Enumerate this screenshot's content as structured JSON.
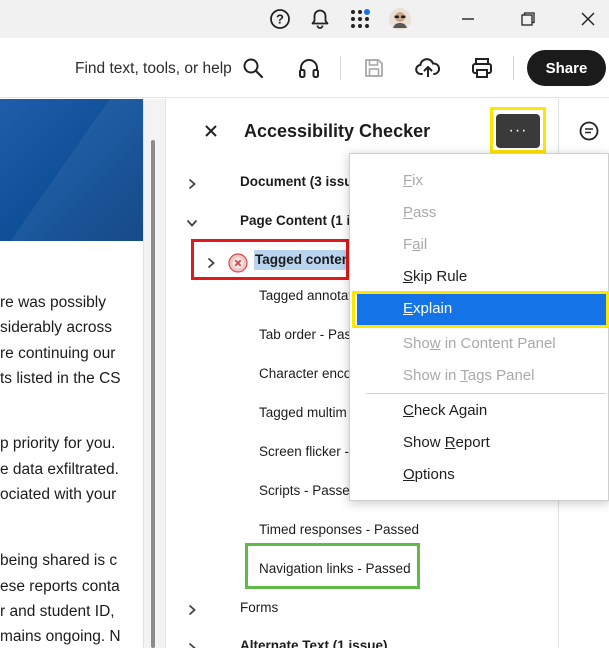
{
  "toolbar": {
    "find_text": "Find text, tools, or help",
    "share_label": "Share"
  },
  "document": {
    "lines": [
      "re was possibly",
      "siderably across",
      "re continuing our",
      "ts listed in the CS",
      "p priority for you.",
      "e data exfiltrated.",
      "ociated with your",
      "being shared is c",
      "ese reports conta",
      "r and student ID,",
      "mains ongoing. N"
    ]
  },
  "panel": {
    "title": "Accessibility Checker",
    "more_label": "···",
    "tree": {
      "document": "Document (3 issu",
      "page_content": "Page Content (1 is",
      "tagged_content": "Tagged conten",
      "tagged_annotations": "Tagged annotat",
      "tab_order": "Tab order - Pass",
      "character_encoding": "Character enco",
      "tagged_multimedia": "Tagged multim",
      "screen_flicker": "Screen flicker -",
      "scripts": "Scripts - Passed",
      "timed_responses": "Timed responses - Passed",
      "navigation_links": "Navigation links - Passed",
      "forms": "Forms",
      "alternate_text": "Alternate Text (1 issue)"
    }
  },
  "menu": {
    "fix": {
      "u": "F",
      "rest": "ix"
    },
    "pass": {
      "u": "P",
      "rest": "ass"
    },
    "fail": {
      "pre": "F",
      "u": "a",
      "rest": "il"
    },
    "skip_rule": {
      "u": "S",
      "rest": "kip Rule"
    },
    "explain": {
      "u": "E",
      "rest": "xplain"
    },
    "show_content": {
      "pre": "Sho",
      "u": "w",
      "rest": " in Content Panel"
    },
    "show_tags": {
      "pre": "Show in ",
      "u": "T",
      "rest": "ags Panel"
    },
    "check_again": {
      "u": "C",
      "rest": "heck Again"
    },
    "show_report": {
      "pre": "Show ",
      "u": "R",
      "rest": "eport"
    },
    "options": {
      "u": "O",
      "rest": "ptions"
    }
  },
  "colors": {
    "menu_highlight": "#1473e6",
    "annotation_yellow": "#ffe600",
    "annotation_red": "#e0191b",
    "annotation_green": "#5dbb46",
    "share_bg": "#1b1b1b"
  }
}
